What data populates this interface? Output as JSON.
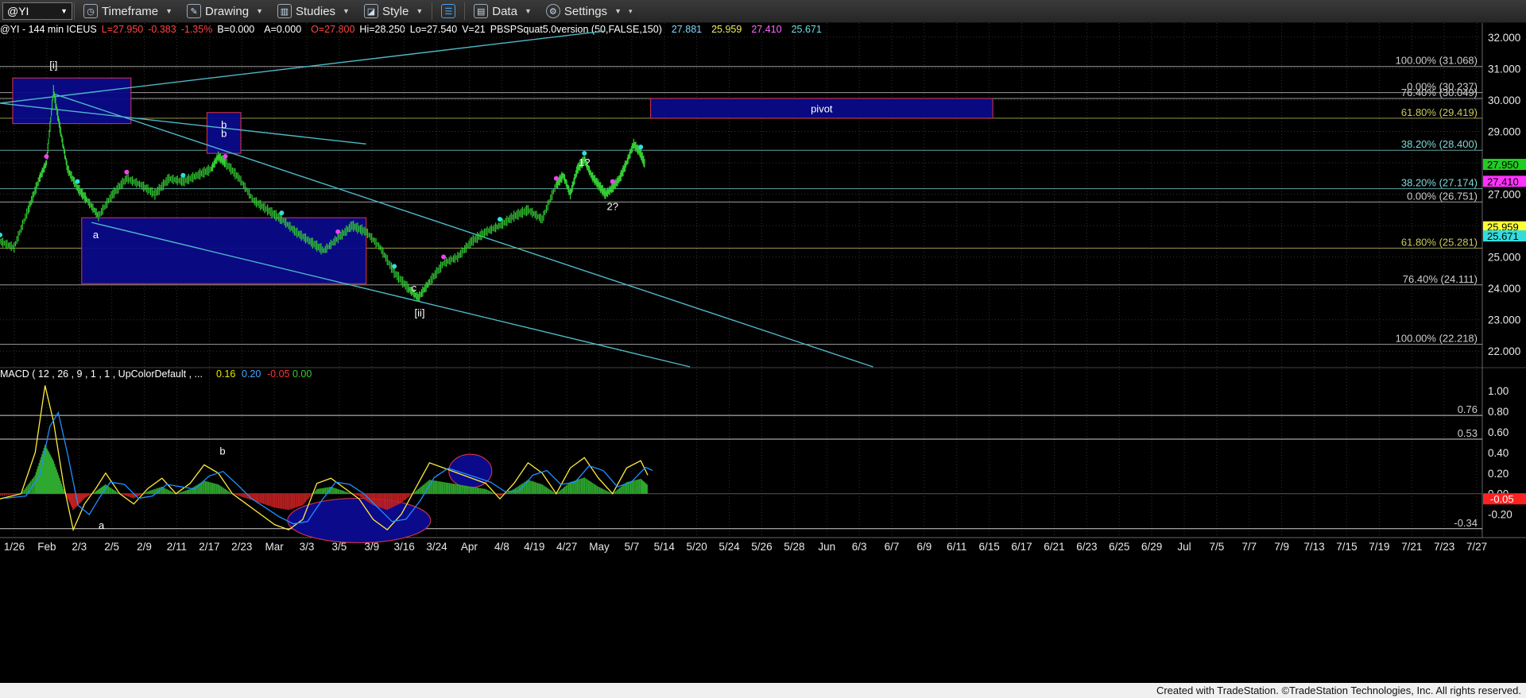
{
  "toolbar": {
    "symbol": "@YI",
    "items": [
      {
        "label": "Timeframe",
        "icon": "clock-icon"
      },
      {
        "label": "Drawing",
        "icon": "pencil-icon"
      },
      {
        "label": "Studies",
        "icon": "studies-icon"
      },
      {
        "label": "Style",
        "icon": "style-icon"
      },
      {
        "label": "",
        "icon": "layout-icon"
      },
      {
        "label": "Data",
        "icon": "data-icon"
      },
      {
        "label": "Settings",
        "icon": "gear-icon"
      }
    ]
  },
  "header": {
    "symbol_info": "@YI - 144 min ICEUS",
    "last": "L=27.950",
    "chg": "-0.383",
    "pct": "-1.35%",
    "b": "B=0.000",
    "a": "A=0.000",
    "o": "O=27.800",
    "hi": "Hi=28.250",
    "lo": "Lo=27.540",
    "v": "V=21",
    "study": "PBSPSquat5.0version (50,FALSE,150)",
    "s1": "27.881",
    "s2": "25.959",
    "s3": "27.410",
    "s4": "25.671"
  },
  "colors": {
    "background": "#000000",
    "price_bars": "#33cc33",
    "trendline": "#4fb8c8",
    "box_fill": "#0a0a8a",
    "box_border": "#c8304a",
    "macd_line": "#ffeb3b",
    "signal_line": "#1e90ff",
    "hist_up": "#2ea82e",
    "hist_down": "#c02020",
    "fib_line": "#8fa8b8",
    "fib_yellow": "#c8c860"
  },
  "chart_data": [
    {
      "type": "line",
      "title": "@YI - 144 min ICEUS",
      "panel": "price",
      "ylim": [
        21.5,
        32.3
      ],
      "y_ticks": [
        "32.000",
        "31.000",
        "30.000",
        "29.000",
        "28.000",
        "27.000",
        "26.000",
        "25.000",
        "24.000",
        "23.000",
        "22.000"
      ],
      "x_ticks": [
        "1/26",
        "Feb",
        "2/3",
        "2/5",
        "2/9",
        "2/11",
        "2/17",
        "2/23",
        "Mar",
        "3/3",
        "3/5",
        "3/9",
        "3/16",
        "3/24",
        "Apr",
        "4/8",
        "4/19",
        "4/27",
        "May",
        "5/7",
        "5/14",
        "5/20",
        "5/24",
        "5/26",
        "5/28",
        "Jun",
        "6/3",
        "6/7",
        "6/9",
        "6/11",
        "6/15",
        "6/17",
        "6/21",
        "6/23",
        "6/25",
        "6/29",
        "Jul",
        "7/5",
        "7/7",
        "7/9",
        "7/13",
        "7/15",
        "7/19",
        "7/21",
        "7/23",
        "7/27"
      ],
      "price_tags": [
        {
          "value": "27.950",
          "color": "#22cc22",
          "text_color": "#000000"
        },
        {
          "value": "27.410",
          "color": "#ff33ff",
          "text_color": "#000000"
        },
        {
          "value": "25.959",
          "color": "#ffff33",
          "text_color": "#000000"
        },
        {
          "value": "25.671",
          "color": "#33dddd",
          "text_color": "#000000"
        }
      ],
      "fib_levels": [
        {
          "label": "100.00% (31.068)",
          "value": 31.068,
          "color": "#cfcfcf"
        },
        {
          "label": "0.00% (30.237)",
          "value": 30.237,
          "color": "#cfcfcf"
        },
        {
          "label": "76.40% (30.049)",
          "value": 30.049,
          "color": "#cfcfcf"
        },
        {
          "label": "61.80% (29.419)",
          "value": 29.419,
          "color": "#c8c860"
        },
        {
          "label": "38.20% (28.400)",
          "value": 28.4,
          "color": "#7fd8d8"
        },
        {
          "label": "38.20% (27.174)",
          "value": 27.174,
          "color": "#7fd8d8"
        },
        {
          "label": "0.00% (26.751)",
          "value": 26.751,
          "color": "#cfcfcf"
        },
        {
          "label": "61.80% (25.281)",
          "value": 25.281,
          "color": "#c8c860"
        },
        {
          "label": "76.40% (24.111)",
          "value": 24.111,
          "color": "#cfcfcf"
        },
        {
          "label": "100.00% (22.218)",
          "value": 22.218,
          "color": "#cfcfcf"
        }
      ],
      "boxes": [
        {
          "label": "",
          "x0": 0.009,
          "x1": 0.093,
          "y0": 30.7,
          "y1": 29.25
        },
        {
          "label": "b",
          "x0": 0.147,
          "x1": 0.171,
          "y0": 29.6,
          "y1": 28.3
        },
        {
          "label": "",
          "x0": 0.058,
          "x1": 0.26,
          "y0": 26.25,
          "y1": 24.15
        },
        {
          "label": "pivot",
          "x0": 0.462,
          "x1": 0.705,
          "y0": 30.05,
          "y1": 29.42
        }
      ],
      "wave_labels": [
        {
          "text": "[i]",
          "x": 0.038,
          "y": 31.0
        },
        {
          "text": "b",
          "x": 0.159,
          "y": 29.1
        },
        {
          "text": "a",
          "x": 0.068,
          "y": 25.6
        },
        {
          "text": "c",
          "x": 0.294,
          "y": 23.9
        },
        {
          "text": "[ii]",
          "x": 0.298,
          "y": 23.1
        },
        {
          "text": "1?",
          "x": 0.415,
          "y": 27.9
        },
        {
          "text": "2?",
          "x": 0.435,
          "y": 26.5
        }
      ],
      "series": [
        {
          "name": "price",
          "x": [
            0.0,
            0.01,
            0.02,
            0.028,
            0.033,
            0.038,
            0.043,
            0.048,
            0.055,
            0.062,
            0.07,
            0.08,
            0.09,
            0.1,
            0.11,
            0.12,
            0.13,
            0.14,
            0.15,
            0.155,
            0.16,
            0.17,
            0.18,
            0.19,
            0.2,
            0.21,
            0.22,
            0.23,
            0.24,
            0.25,
            0.26,
            0.27,
            0.28,
            0.29,
            0.297,
            0.305,
            0.315,
            0.325,
            0.335,
            0.345,
            0.355,
            0.365,
            0.375,
            0.385,
            0.395,
            0.4,
            0.405,
            0.41,
            0.415,
            0.42,
            0.425,
            0.43,
            0.435,
            0.44,
            0.445,
            0.45,
            0.455,
            0.458
          ],
          "y": [
            25.5,
            25.3,
            26.5,
            27.5,
            28.0,
            30.3,
            29.0,
            27.8,
            27.2,
            26.8,
            26.3,
            27.0,
            27.5,
            27.3,
            27.0,
            27.5,
            27.4,
            27.6,
            27.8,
            28.2,
            28.0,
            27.5,
            26.8,
            26.5,
            26.2,
            25.8,
            25.5,
            25.2,
            25.6,
            26.0,
            25.8,
            25.3,
            24.5,
            24.0,
            23.7,
            24.2,
            24.8,
            25.0,
            25.5,
            25.8,
            26.0,
            26.3,
            26.5,
            26.2,
            27.3,
            27.6,
            27.0,
            27.8,
            28.1,
            27.6,
            27.3,
            27.0,
            27.2,
            27.5,
            28.0,
            28.6,
            28.3,
            27.95
          ]
        }
      ]
    },
    {
      "type": "area",
      "title": "MACD ( 12 , 26 , 9 , 1 , 1 , UpColorDefault , ...",
      "panel": "macd",
      "readouts": [
        {
          "value": "0.16",
          "color": "#e8e800"
        },
        {
          "value": "0.20",
          "color": "#4aa8ff"
        },
        {
          "value": "-0.05",
          "color": "#ff3333"
        },
        {
          "value": "0.00",
          "color": "#33cc33"
        }
      ],
      "ylim": [
        -0.38,
        1.1
      ],
      "y_ticks": [
        "1.00",
        "0.80",
        "0.60",
        "0.40",
        "0.20",
        "0.00",
        "-0.20"
      ],
      "levels": [
        {
          "label": "0.76",
          "value": 0.76
        },
        {
          "label": "0.53",
          "value": 0.53
        },
        {
          "label": "-0.34",
          "value": -0.34
        }
      ],
      "tag": {
        "value": "-0.05",
        "color": "#ff2222"
      },
      "wave_labels": [
        {
          "text": "b",
          "x": 0.158,
          "y": 0.38
        },
        {
          "text": "a",
          "x": 0.072,
          "y": -0.34
        }
      ],
      "series": [
        {
          "name": "MACD",
          "x": [
            0.0,
            0.015,
            0.025,
            0.032,
            0.038,
            0.045,
            0.052,
            0.06,
            0.068,
            0.075,
            0.085,
            0.095,
            0.105,
            0.115,
            0.125,
            0.135,
            0.145,
            0.155,
            0.165,
            0.175,
            0.185,
            0.195,
            0.205,
            0.215,
            0.225,
            0.235,
            0.245,
            0.255,
            0.265,
            0.275,
            0.285,
            0.295,
            0.305,
            0.315,
            0.325,
            0.335,
            0.345,
            0.355,
            0.365,
            0.375,
            0.385,
            0.395,
            0.405,
            0.415,
            0.425,
            0.435,
            0.445,
            0.455,
            0.46
          ],
          "y": [
            -0.05,
            0.0,
            0.4,
            1.05,
            0.7,
            0.1,
            -0.35,
            -0.1,
            0.05,
            0.2,
            0.0,
            -0.1,
            0.05,
            0.15,
            0.0,
            0.1,
            0.28,
            0.2,
            0.0,
            -0.1,
            -0.2,
            -0.3,
            -0.35,
            -0.25,
            0.1,
            0.15,
            0.05,
            -0.05,
            -0.25,
            -0.35,
            -0.2,
            0.05,
            0.3,
            0.25,
            0.2,
            0.15,
            0.1,
            -0.05,
            0.1,
            0.3,
            0.2,
            0.0,
            0.25,
            0.35,
            0.15,
            0.0,
            0.25,
            0.32,
            0.18
          ]
        }
      ]
    }
  ],
  "footer": {
    "credit": "Created with TradeStation. ©TradeStation Technologies, Inc. All rights reserved."
  }
}
